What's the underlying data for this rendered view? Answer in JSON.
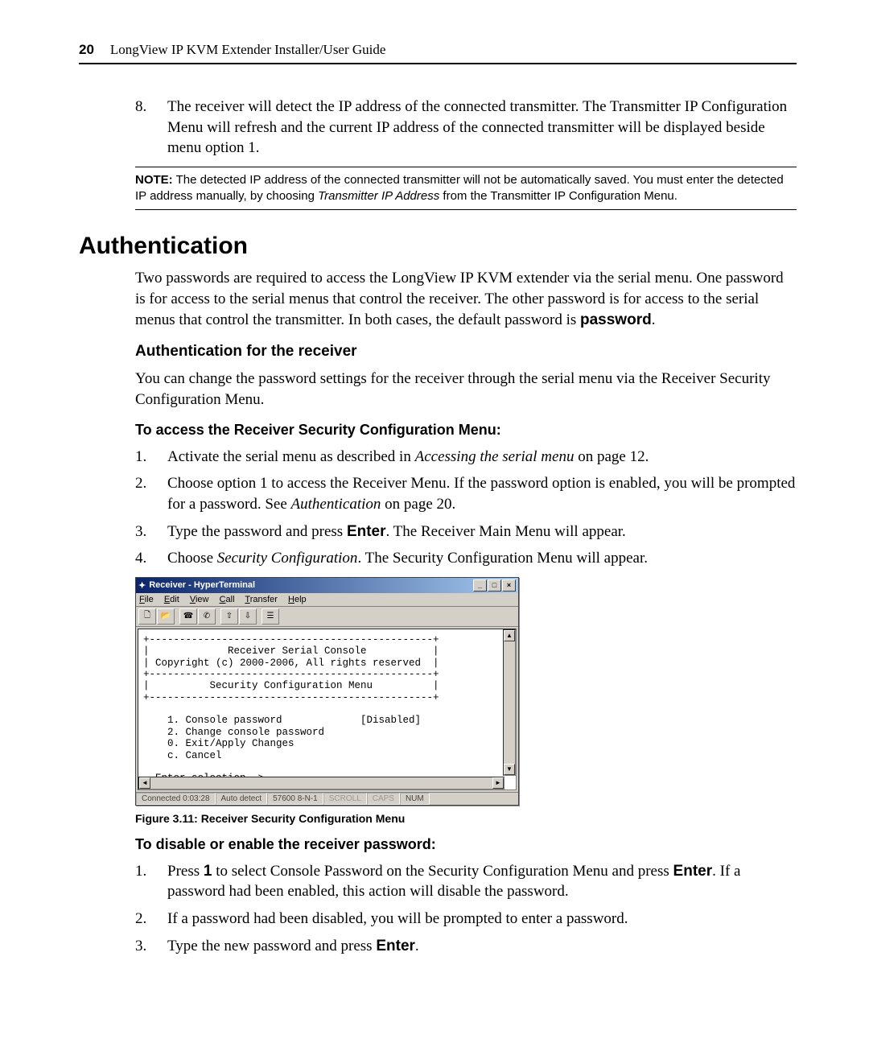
{
  "header": {
    "page_number": "20",
    "doc_title": "LongView IP KVM Extender Installer/User Guide"
  },
  "step8": {
    "num": "8.",
    "text": "The receiver will detect the IP address of the connected transmitter. The Transmitter IP Configuration Menu will refresh and the current IP address of the connected transmitter will be displayed beside menu option 1."
  },
  "note": {
    "label": "NOTE:",
    "text_a": " The detected IP address of the connected transmitter will not be automatically saved. You must enter the detected IP address manually, by choosing ",
    "italic": "Transmitter IP Address",
    "text_b": " from the Transmitter IP Configuration Menu."
  },
  "h1": "Authentication",
  "auth_intro_a": "Two passwords are required to access the LongView IP KVM extender via the serial menu. One password is for access to the serial menus that control the receiver. The other password is for access to the serial menus that control the transmitter. In both cases, the default password is ",
  "auth_intro_bold": "password",
  "auth_intro_b": ".",
  "sub1": "Authentication for the receiver",
  "sub1_p": "You can change the password settings for the receiver through the serial menu via the Receiver Security Configuration Menu.",
  "proc1_title": "To access the Receiver Security Configuration Menu:",
  "proc1_steps": [
    {
      "num": "1.",
      "pre": "Activate the serial menu as described in ",
      "italic": "Accessing the serial menu",
      "post": " on page 12."
    },
    {
      "num": "2.",
      "pre": "Choose option 1 to access the Receiver Menu. If the password option is enabled, you will be prompted for a password. See ",
      "italic": "Authentication",
      "post": " on page 20."
    },
    {
      "num": "3.",
      "pre": "Type the password and press ",
      "bold": "Enter",
      "post": ". The Receiver Main Menu will appear."
    },
    {
      "num": "4.",
      "pre": "Choose ",
      "italic": "Security Configuration",
      "post": ". The Security Configuration Menu will appear."
    }
  ],
  "ht": {
    "title": "Receiver - HyperTerminal",
    "menu": [
      "File",
      "Edit",
      "View",
      "Call",
      "Transfer",
      "Help"
    ],
    "terminal_text": "+-----------------------------------------------+\n|             Receiver Serial Console           |\n| Copyright (c) 2000-2006, All rights reserved  |\n+-----------------------------------------------+\n|          Security Configuration Menu          |\n+-----------------------------------------------+\n\n    1. Console password             [Disabled]\n    2. Change console password\n    0. Exit/Apply Changes\n    c. Cancel\n\n  Enter selection -> _",
    "status": {
      "connected": "Connected 0:03:28",
      "detect": "Auto detect",
      "baud": "57600 8-N-1",
      "scroll": "SCROLL",
      "caps": "CAPS",
      "num": "NUM"
    }
  },
  "fig_caption": "Figure 3.11: Receiver Security Configuration Menu",
  "proc2_title": "To disable or enable the receiver password:",
  "proc2_steps": [
    {
      "num": "1.",
      "pre": "Press ",
      "bold": "1",
      "post_a": " to select Console Password on the Security Configuration Menu and press ",
      "bold2": "Enter",
      "post_b": ". If a password had been enabled, this action will disable the password."
    },
    {
      "num": "2.",
      "pre": "If a password had been disabled, you will be prompted to enter a password."
    },
    {
      "num": "3.",
      "pre": "Type the new password and press ",
      "bold": "Enter",
      "post": "."
    }
  ]
}
